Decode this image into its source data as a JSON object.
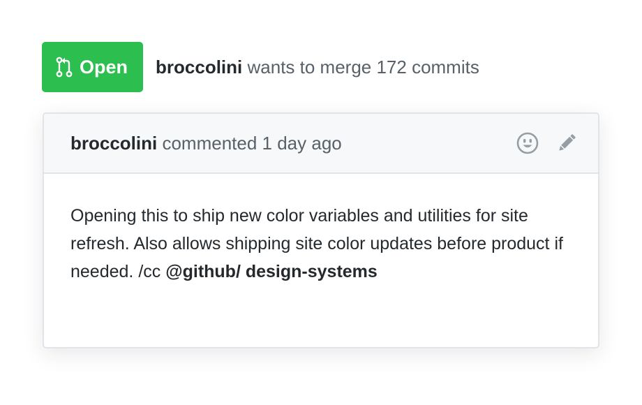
{
  "pr": {
    "state_label": "Open",
    "author": "broccolini",
    "merge_text": " wants to merge 172 commits"
  },
  "comment": {
    "author": "broccolini",
    "action_text": " commented 1 day ago",
    "body_text": "Opening this to ship new color variables and utilities for site refresh. Also allows shipping site color updates before product if needed. /cc ",
    "mention": "@github/ design-systems",
    "actions": [
      "smiley-icon",
      "pencil-icon"
    ]
  },
  "colors": {
    "open_green": "#2cbe4e",
    "header_bg": "#f6f8fa",
    "border": "#e1e4e8",
    "muted_text": "#586069",
    "text": "#24292e",
    "icon_gray": "#959da5"
  }
}
